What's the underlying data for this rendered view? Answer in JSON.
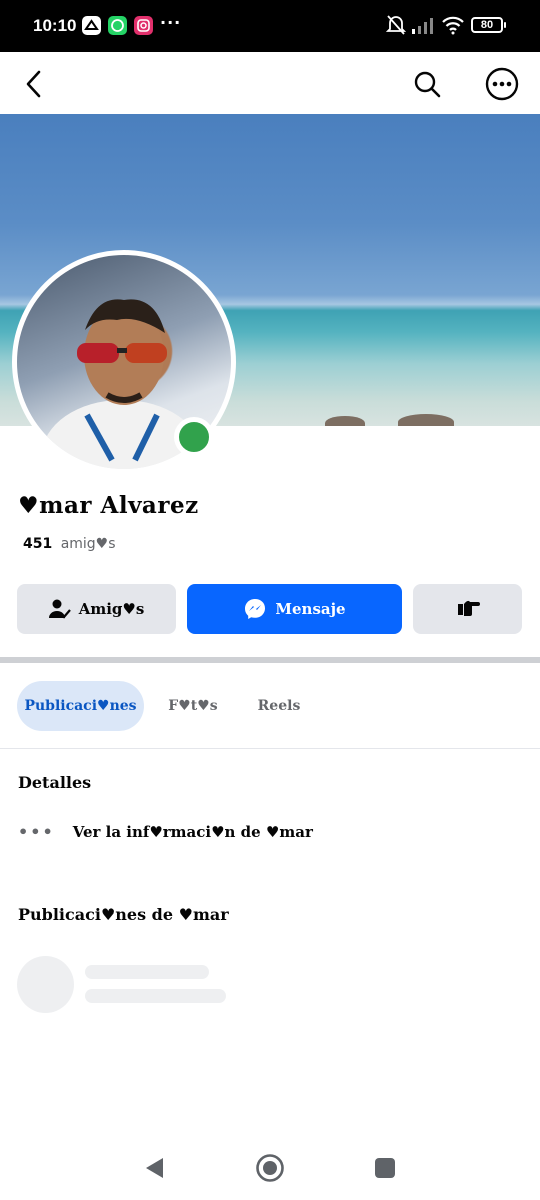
{
  "status_bar": {
    "time": "10:10",
    "app_icons": [
      "drive-icon",
      "whatsapp-icon",
      "instagram-icon"
    ],
    "more": "···",
    "battery": "80",
    "colors": {
      "background": "#000000",
      "whatsapp": "#25d366",
      "instagram": "#e1306c"
    }
  },
  "header": {
    "back_icon": "back-arrow-icon",
    "search_icon": "search-icon",
    "menu_icon": "more-options-icon"
  },
  "profile": {
    "name": "♥mar Alvarez",
    "friends_count": "451",
    "friends_label": "amig♥s",
    "online": true
  },
  "actions": {
    "friends_label": "Amig♥s",
    "message_label": "Mensaje",
    "more_icon": "hand-point-icon",
    "colors": {
      "primary": "#0866ff",
      "secondary": "#e4e6eb"
    }
  },
  "tabs": [
    {
      "label": "Publicaci♥nes",
      "active": true
    },
    {
      "label": "F♥t♥s",
      "active": false
    },
    {
      "label": "Reels",
      "active": false
    }
  ],
  "details": {
    "title": "Detalles",
    "dots": "•••",
    "info_label": "Ver la inf♥rmaci♥n de ♥mar"
  },
  "posts": {
    "title": "Publicaci♥nes de ♥mar"
  },
  "nav_bar": {
    "back": "back-triangle-icon",
    "home": "home-circle-icon",
    "recents": "recents-square-icon"
  }
}
